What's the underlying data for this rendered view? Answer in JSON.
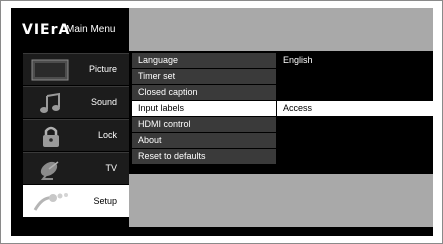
{
  "header": {
    "logo": "VIErA",
    "title": "Main Menu"
  },
  "sidebar": {
    "items": [
      {
        "label": "Picture",
        "icon": "picture-icon",
        "active": false
      },
      {
        "label": "Sound",
        "icon": "music-note-icon",
        "active": false
      },
      {
        "label": "Lock",
        "icon": "padlock-icon",
        "active": false
      },
      {
        "label": "TV",
        "icon": "satellite-dish-icon",
        "active": false
      },
      {
        "label": "Setup",
        "icon": "setup-icon",
        "active": true
      }
    ]
  },
  "settings": {
    "rows": [
      {
        "label": "Language",
        "value": "English"
      },
      {
        "label": "Timer set",
        "value": ""
      },
      {
        "label": "Closed caption",
        "value": ""
      },
      {
        "label": "Input labels",
        "value": "Access"
      },
      {
        "label": "HDMI control",
        "value": ""
      },
      {
        "label": "About",
        "value": ""
      },
      {
        "label": "Reset to defaults",
        "value": ""
      }
    ],
    "selected_index": 3
  },
  "colors": {
    "background": "#000000",
    "panel_gray": "#a9a9a9",
    "row_gray": "#3a3a3a",
    "highlight": "#ffffff"
  }
}
